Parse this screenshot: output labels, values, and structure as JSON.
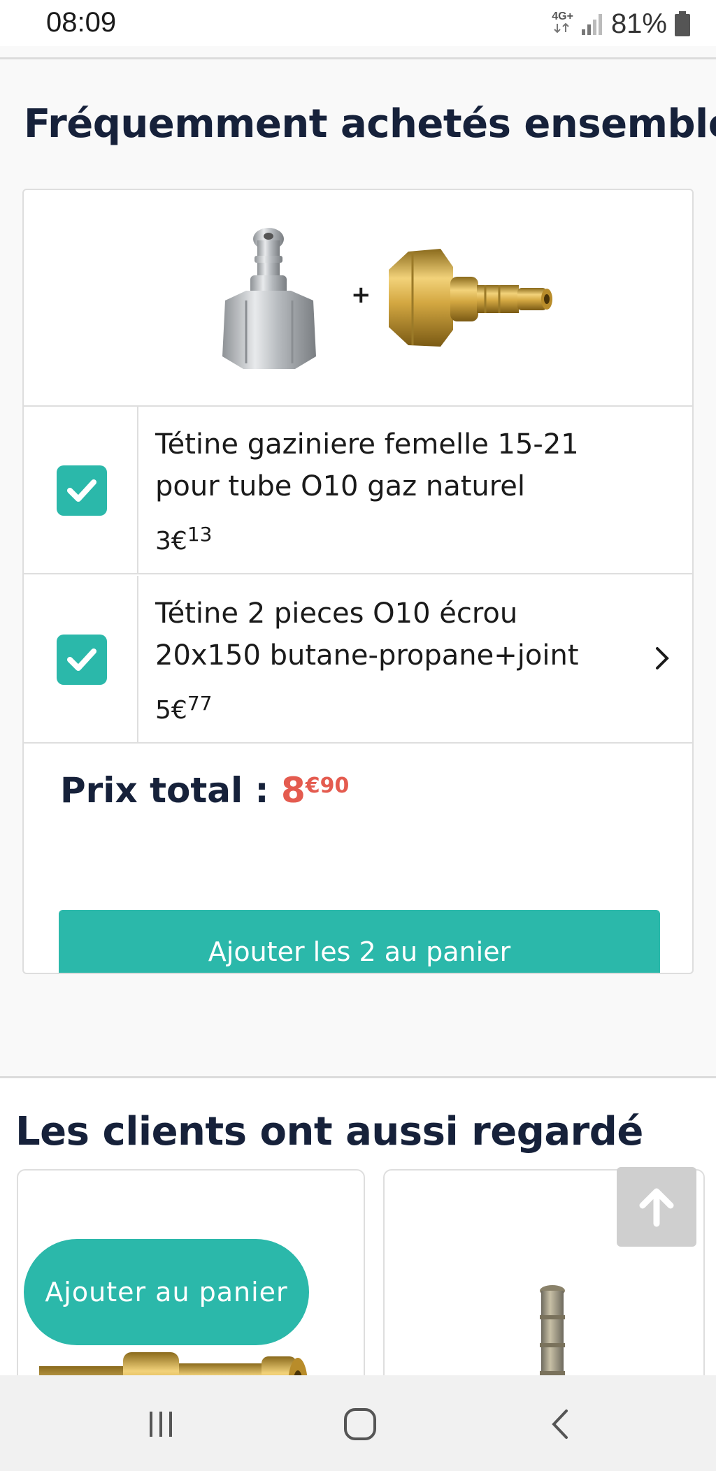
{
  "status_bar": {
    "time": "08:09",
    "network": "4G+",
    "battery_percent": "81%",
    "icons": [
      "network-4g-icon",
      "signal-icon",
      "battery-icon"
    ]
  },
  "frequently_bought": {
    "title": "Fréquemment achetés ensemble",
    "plus_sign": "+",
    "products": [
      {
        "name": "Tétine gaziniere femelle 15-21 pour tube O10 gaz naturel",
        "price_whole": "3€",
        "price_cents": "13",
        "checked": true
      },
      {
        "name": "Tétine 2 pieces O10 écrou 20x150 butane-propane+joint",
        "price_whole": "5€",
        "price_cents": "77",
        "checked": true
      }
    ],
    "total_label": "Prix total : ",
    "total_whole": "8",
    "total_cents": "€90",
    "add_button_label": "Ajouter les 2 au panier"
  },
  "also_viewed": {
    "title": "Les clients ont aussi regardé"
  },
  "floating": {
    "add_to_cart_label": "Ajouter au panier",
    "scroll_top_icon": "arrow-up-icon"
  },
  "navigation": {
    "buttons": [
      "recent-apps-icon",
      "home-icon",
      "back-icon"
    ]
  },
  "colors": {
    "accent": "#2bb8aa",
    "price_red": "#e45b4f",
    "heading": "#16213a"
  }
}
